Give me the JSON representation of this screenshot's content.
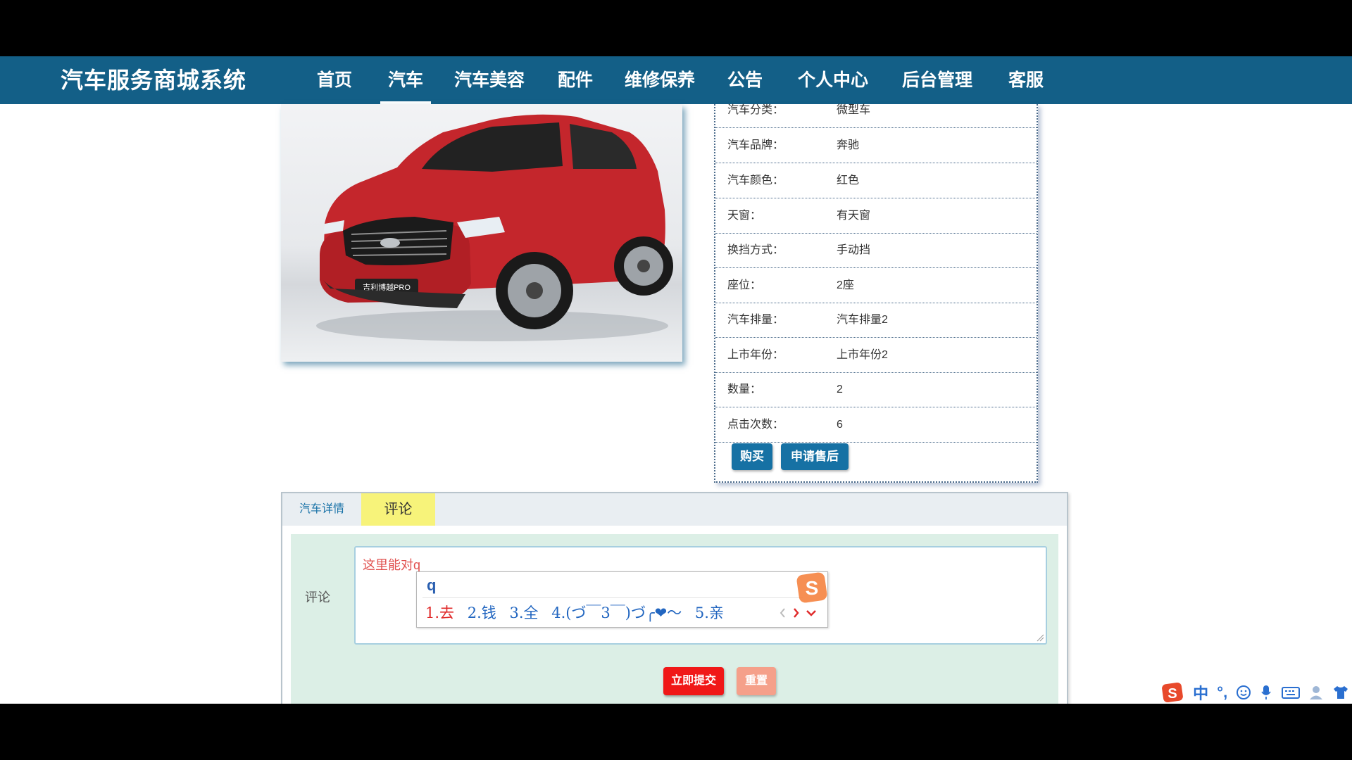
{
  "brand": "汽车服务商城系统",
  "nav": [
    "首页",
    "汽车",
    "汽车美容",
    "配件",
    "维修保养",
    "公告",
    "个人中心",
    "后台管理",
    "客服"
  ],
  "active_nav": "汽车",
  "car": {
    "badge": "吉利博越PRO",
    "color_hex": "#c4262c"
  },
  "specs": [
    {
      "label": "汽车分类：",
      "value": "微型车"
    },
    {
      "label": "汽车品牌：",
      "value": "奔驰"
    },
    {
      "label": "汽车颜色：",
      "value": "红色"
    },
    {
      "label": "天窗：",
      "value": "有天窗"
    },
    {
      "label": "换挡方式：",
      "value": "手动挡"
    },
    {
      "label": "座位：",
      "value": "2座"
    },
    {
      "label": "汽车排量：",
      "value": "汽车排量2"
    },
    {
      "label": "上市年份：",
      "value": "上市年份2"
    },
    {
      "label": "数量：",
      "value": "2"
    },
    {
      "label": "点击次数：",
      "value": "6"
    }
  ],
  "buttons": {
    "buy": "购买",
    "after_sales": "申请售后"
  },
  "tabs": {
    "details": "汽车详情",
    "comments": "评论"
  },
  "form": {
    "label": "评论",
    "comment_value": "这里能对q",
    "submit": "立即提交",
    "reset": "重置"
  },
  "ime": {
    "input": "q",
    "candidates": [
      "1.去",
      "2.钱",
      "3.全",
      "4.(づ￣3￣)づ╭❤～",
      "5.亲"
    ],
    "logo": "S",
    "icons": [
      "sogou-logo-icon",
      "chevron-left-icon",
      "chevron-right-icon",
      "chevron-down-icon"
    ]
  },
  "tray": {
    "lang": "中",
    "punct": "°,",
    "icons": [
      "sogou-logo-icon",
      "emoji-icon",
      "microphone-icon",
      "keyboard-icon",
      "user-icon",
      "shirt-icon"
    ]
  },
  "colors": {
    "nav_bg": "#135f87",
    "button_blue": "#1671a4",
    "submit_red": "#f01818",
    "reset_salmon": "#f5a08a",
    "tab_active": "#f7f37a",
    "form_bg": "#dcefe6"
  }
}
